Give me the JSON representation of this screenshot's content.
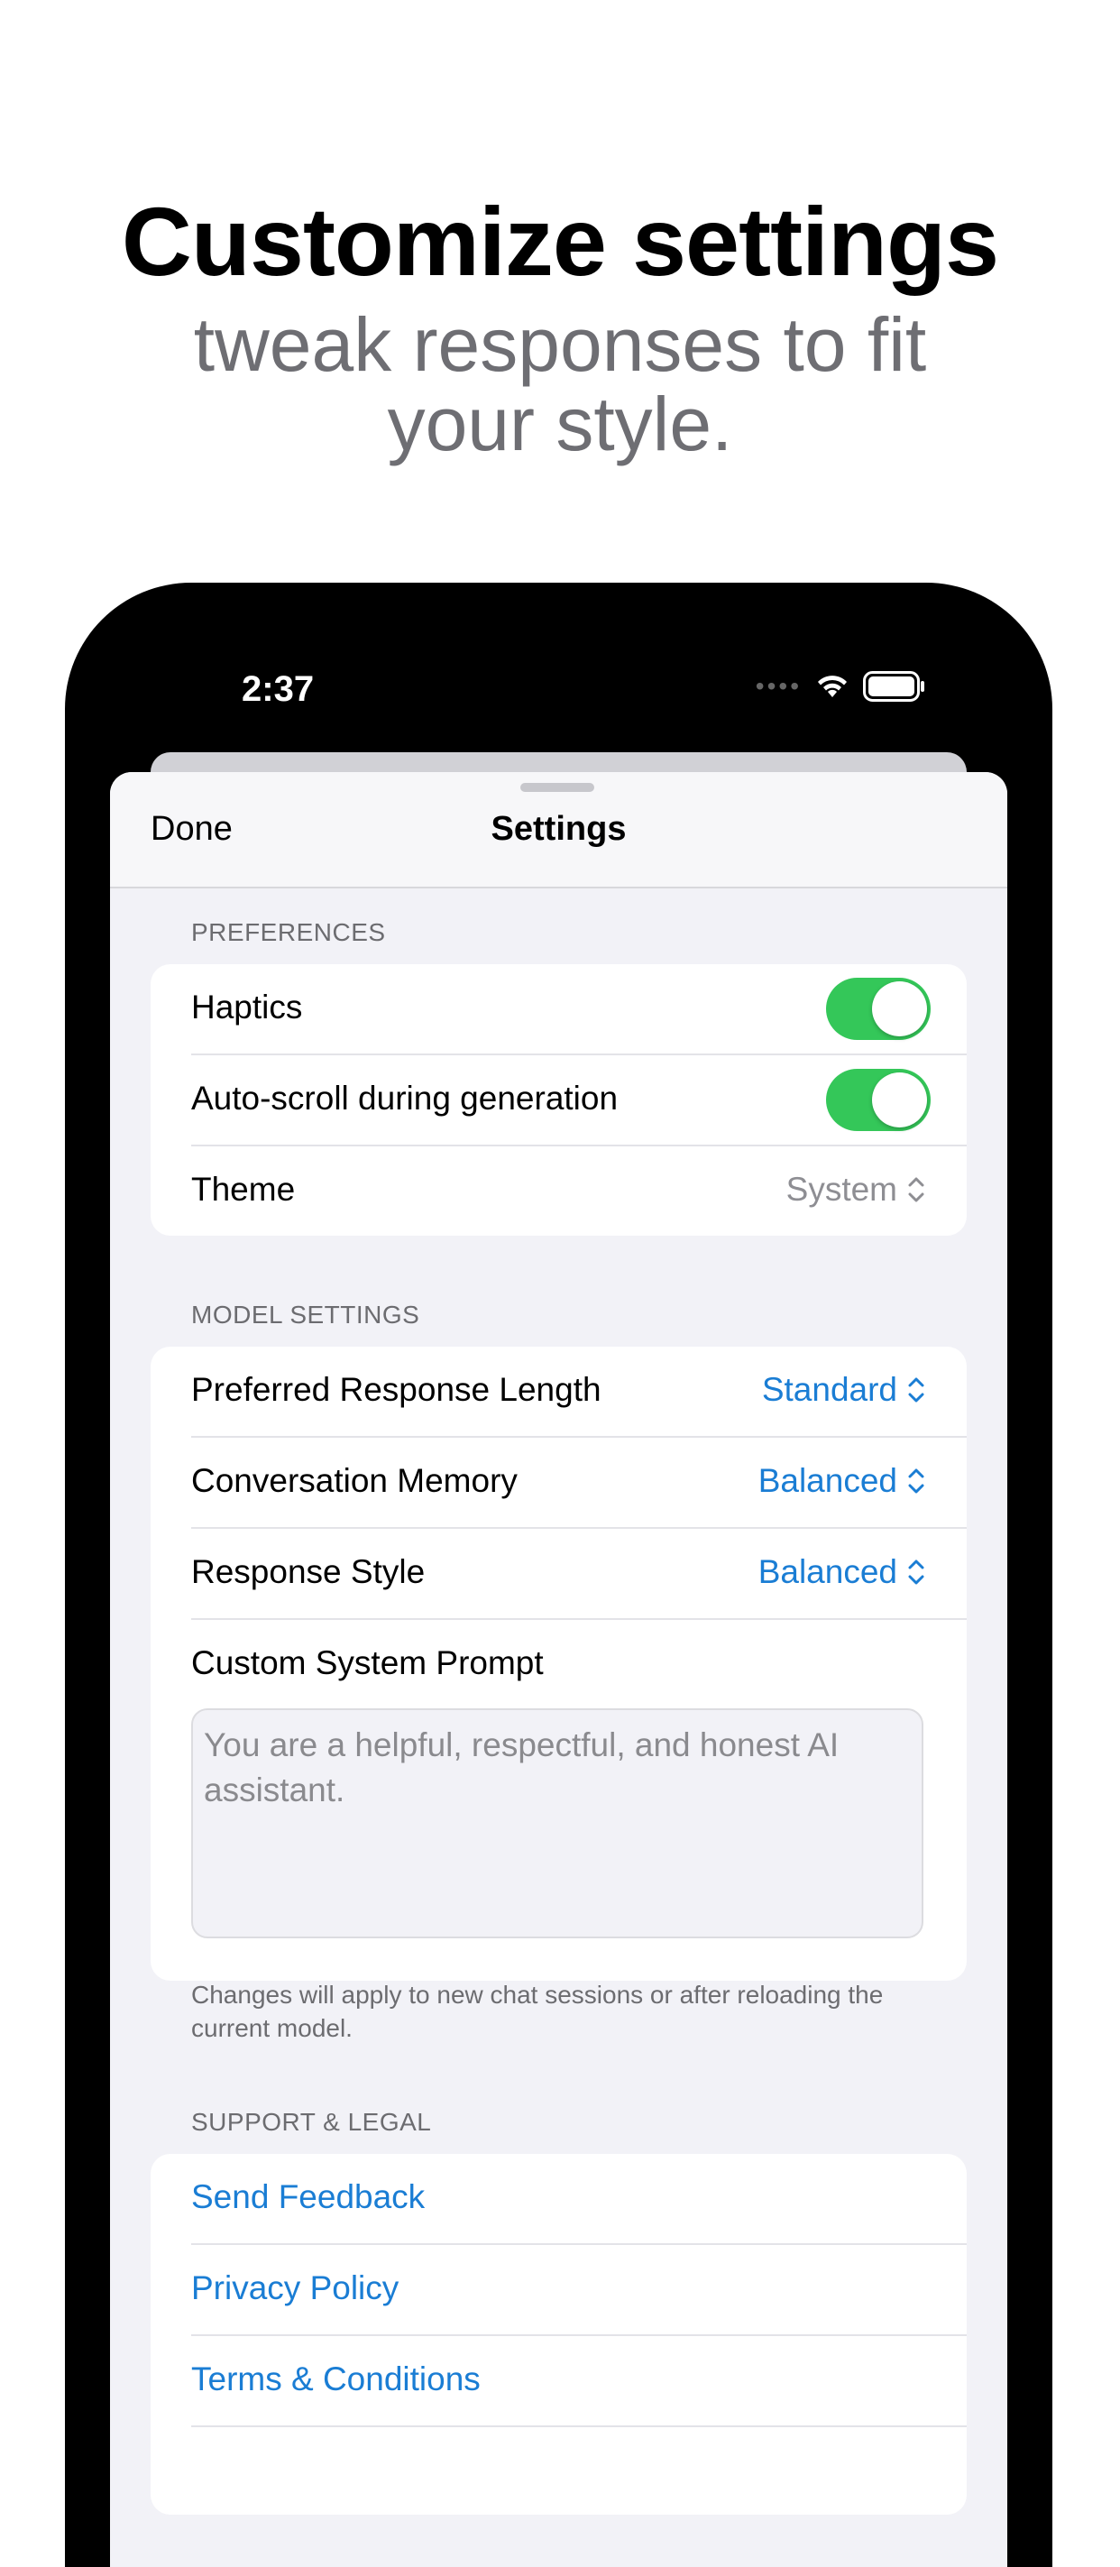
{
  "promo": {
    "headline": "Customize settings",
    "subline": "tweak responses to fit your style."
  },
  "status_bar": {
    "time": "2:37",
    "icons": [
      "cellular-dots-icon",
      "wifi-icon",
      "battery-icon"
    ]
  },
  "nav": {
    "done_label": "Done",
    "title": "Settings"
  },
  "preferences": {
    "header": "PREFERENCES",
    "haptics_label": "Haptics",
    "haptics_on": true,
    "autoscroll_label": "Auto-scroll during generation",
    "autoscroll_on": true,
    "theme_label": "Theme",
    "theme_value": "System"
  },
  "model_settings": {
    "header": "MODEL SETTINGS",
    "response_length_label": "Preferred Response Length",
    "response_length_value": "Standard",
    "memory_label": "Conversation Memory",
    "memory_value": "Balanced",
    "style_label": "Response Style",
    "style_value": "Balanced",
    "prompt_label": "Custom System Prompt",
    "prompt_text": "You are a helpful, respectful, and honest AI assistant.",
    "footer": "Changes will apply to new chat sessions or after reloading the current model."
  },
  "support": {
    "header": "SUPPORT & LEGAL",
    "links": [
      "Send Feedback",
      "Privacy Policy",
      "Terms & Conditions"
    ]
  },
  "colors": {
    "accent": "#1a7dd4",
    "toggle_on": "#34c759",
    "background": "#f2f2f7"
  }
}
